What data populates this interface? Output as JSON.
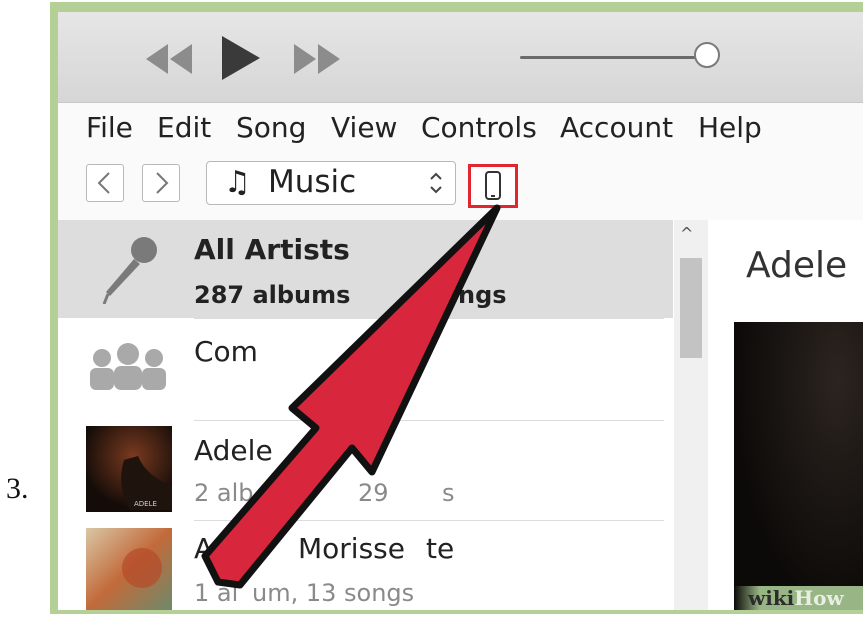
{
  "step_number": "3.",
  "toolbar": {
    "prev_icon": "rewind-icon",
    "play_icon": "play-icon",
    "next_icon": "fast-forward-icon",
    "volume_icon": "volume-slider"
  },
  "menu": {
    "items": [
      "File",
      "Edit",
      "Song",
      "View",
      "Controls",
      "Account",
      "Help"
    ]
  },
  "nav": {
    "back_icon": "chevron-left-icon",
    "forward_icon": "chevron-right-icon",
    "media_type": "Music",
    "media_icon": "music-note-icon",
    "device_icon": "iphone-icon"
  },
  "sidebar": {
    "rows": [
      {
        "title": "All Artists",
        "subtitle": "287 albums, ... songs",
        "subtitle_visible": "287 albums",
        "subtitle_tail": "ngs",
        "icon": "microphone-icon",
        "selected": true
      },
      {
        "title": "Com",
        "subtitle": "",
        "icon": "group-icon",
        "selected": false
      },
      {
        "title": "Adele",
        "subtitle_left": "2 alb",
        "subtitle_mid": "29",
        "subtitle_tail": "s",
        "icon": "album-art-adele",
        "selected": false
      },
      {
        "title_left": "A",
        "title_right": "Morisse",
        "title_tail": "te",
        "subtitle_left": "1 al",
        "subtitle_right": "um, 13 songs",
        "icon": "album-art-morissette",
        "selected": false
      }
    ]
  },
  "detail": {
    "heading": "Adele"
  },
  "watermark": {
    "part1": "wiki",
    "part2": "How"
  },
  "colors": {
    "highlight_red": "#e2262f",
    "arrow_red": "#d8273c",
    "frame_green": "#b4d097"
  }
}
